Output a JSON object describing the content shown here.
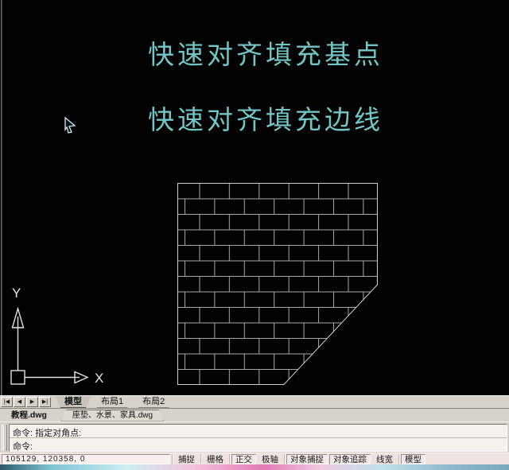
{
  "canvas": {
    "annotation_line1": "快速对齐填充基点",
    "annotation_line2": "快速对齐填充边线",
    "annotation_color": "#74c6c6",
    "hatch": {
      "pattern": "brick",
      "line_color": "#a8a8a8",
      "outline_color": "#cfcfcf"
    },
    "ucs": {
      "x_label": "X",
      "y_label": "Y"
    }
  },
  "layout_tabbar": {
    "nav": {
      "first": "|◀",
      "prev": "◀",
      "next": "▶",
      "last": "▶|"
    },
    "tabs": [
      {
        "label": "模型",
        "active": true
      },
      {
        "label": "布局1",
        "active": false
      },
      {
        "label": "布局2",
        "active": false
      }
    ]
  },
  "doc_tabbar": {
    "tabs": [
      {
        "label": "教程.dwg",
        "active": true
      },
      {
        "label": "座垫、水景、家具.dwg",
        "active": false
      }
    ]
  },
  "command_window": {
    "lines": [
      "命令: 指定对角点:",
      "命令:"
    ]
  },
  "status_bar": {
    "coordinates": "105129, 120358, 0",
    "buttons": [
      {
        "label": "捕捉",
        "pressed": false
      },
      {
        "label": "栅格",
        "pressed": false
      },
      {
        "label": "正交",
        "pressed": true
      },
      {
        "label": "极轴",
        "pressed": false
      },
      {
        "label": "对象捕捉",
        "pressed": true
      },
      {
        "label": "对象追踪",
        "pressed": true
      },
      {
        "label": "线宽",
        "pressed": false
      },
      {
        "label": "模型",
        "pressed": true
      }
    ]
  }
}
